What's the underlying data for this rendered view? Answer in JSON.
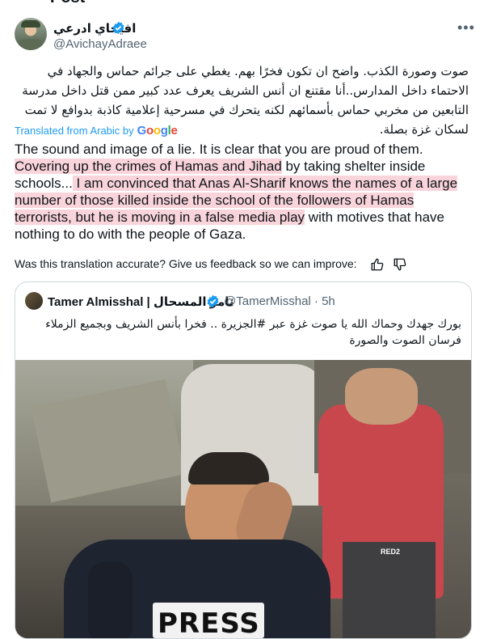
{
  "page": {
    "title": "Post"
  },
  "tweet": {
    "author_name": "افيخاي ادرعي",
    "handle": "@AvichayAdraee",
    "text_arabic": "صوت وصورة الكذب. واضح ان تكون فخرًا بهم. يغطي على جرائم حماس والجهاد في الاحتماء داخل المدارس..أنا مقتنع ان أنس الشريف يعرف عدد كبير ممن قتل داخل مدرسة التابعين من مخربي حماس بأسمائهم لكنه يتحرك في مسرحية إعلامية كاذبة بدوافع لا تمت لسكان غزة بصلة.",
    "translated_from": "Translated from Arabic by",
    "translator_brand": "Google",
    "translation": {
      "p1": "The sound and image of a lie. It is clear that you are proud of them.",
      "p2a": "Covering up the crimes of Hama",
      "p2b": "s",
      "p2c": " and Jihad",
      "p2d": " by taking shelter inside schools...",
      "p3a": " I am convinced that Anas Al-Sharif knows the names of a large number of those killed inside the school of the followers of Hamas terrorists, but he is moving in a false media play",
      "p3b": " with motives that have nothing to do with the people of Gaza."
    },
    "feedback_prompt": "Was this translation accurate? Give us feedback so we can improve:"
  },
  "quoted": {
    "name": "Tamer Almisshal | تامر المسحال",
    "handle": "@TamerMisshal",
    "separator": "·",
    "time": "5h",
    "text": "بورك جهدك وحماك الله يا صوت غزة عبر #الجزيرة .. فخرا بأنس الشريف وبجميع الزملاء فرسان الصوت والصورة",
    "photo_vest_label": "PRESS",
    "photo_shirt_label": "RED2"
  },
  "colors": {
    "accent": "#1d9bf0",
    "highlight": "#f9d4da",
    "secondary_text": "#536471"
  },
  "icons": [
    "verified-badge-icon",
    "more-icon",
    "thumbs-up-icon",
    "thumbs-down-icon"
  ]
}
